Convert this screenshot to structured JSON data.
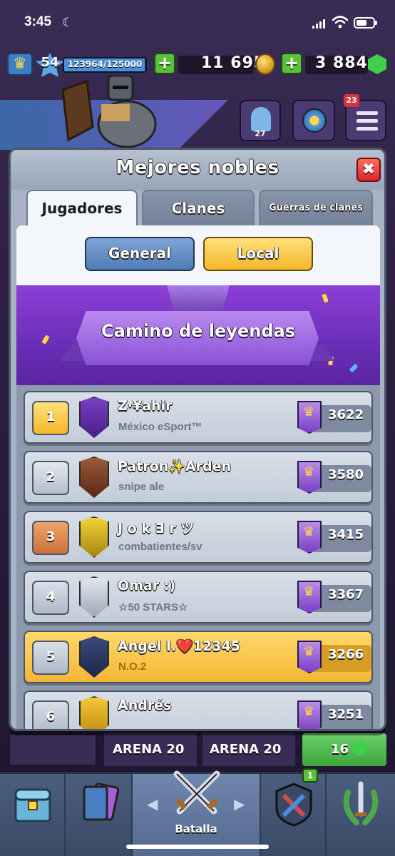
{
  "status_bar": {
    "time": "3:45"
  },
  "resources": {
    "level": "54",
    "xp": "123964/125000",
    "xp_fraction": 0.99,
    "gold": "11 695",
    "gems": "3 884"
  },
  "header": {
    "friends_count": "27",
    "notifications": "23"
  },
  "modal": {
    "title": "Mejores nobles",
    "close_label": "✖",
    "tabs": [
      {
        "label": "Jugadores"
      },
      {
        "label": "Clanes"
      },
      {
        "label": "Guerras de clanes"
      }
    ],
    "filters": {
      "general": "General",
      "local": "Local"
    },
    "banner": "Camino de leyendas",
    "players": [
      {
        "rank": "1",
        "name": "Z·¥ahir",
        "clan": "México eSport™",
        "trophies": "3622"
      },
      {
        "rank": "2",
        "name": "Patron✨Arden",
        "clan": "snipe ale",
        "trophies": "3580"
      },
      {
        "rank": "3",
        "name": "J o k ∃ r ツ",
        "clan": "combatientes/sv",
        "trophies": "3415"
      },
      {
        "rank": "4",
        "name": "Omar :)",
        "clan": "☆50 STARS☆",
        "trophies": "3367"
      },
      {
        "rank": "5",
        "name": "Angel I.❤️12345",
        "clan": "N.O.2",
        "trophies": "3266"
      },
      {
        "rank": "6",
        "name": "Andrés",
        "clan": "",
        "trophies": "3251"
      }
    ]
  },
  "background": {
    "arena_left": "ARENA 20",
    "arena_right": "ARENA 20",
    "side_count": "16"
  },
  "bottom_nav": {
    "battle_label": "Batalla",
    "clan_badge": "1"
  },
  "colors": {
    "highlight_row": "#f2b733",
    "rank_gold": "#f4b52a",
    "rank_bronze": "#c9723a",
    "legend_purple": "#6a2eb8",
    "close_red": "#d8272c"
  }
}
